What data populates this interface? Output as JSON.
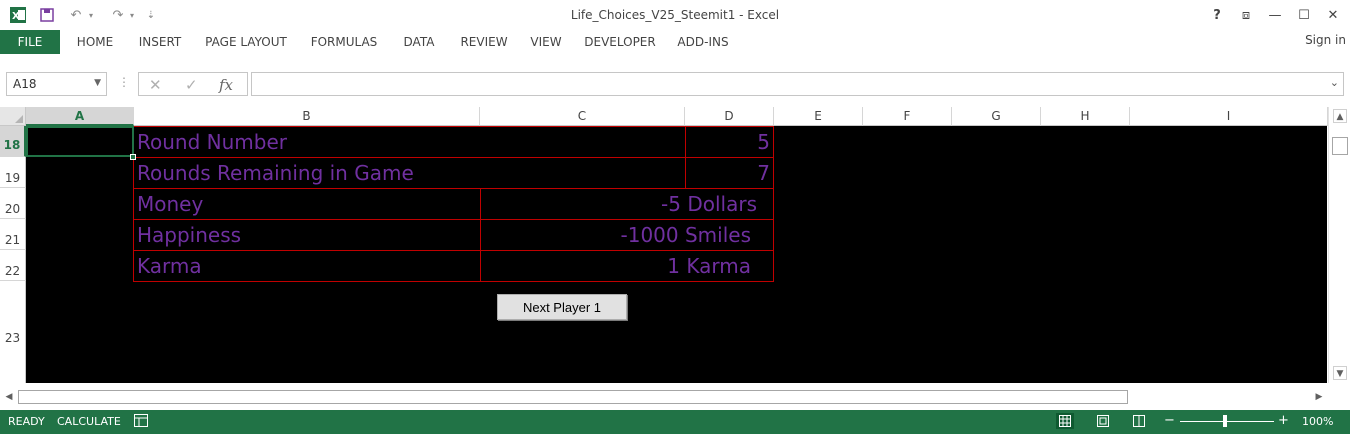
{
  "window": {
    "title": "Life_Choices_V25_Steemit1 - Excel",
    "help_icon": "?",
    "restore_ribbon_icon": "⧈",
    "minimize_icon": "—",
    "maximize_icon": "☐",
    "close_icon": "✕"
  },
  "quick_access": {
    "save_icon": "💾",
    "undo_icon": "↶",
    "redo_icon": "↷",
    "customize_icon": "⇣"
  },
  "ribbon": {
    "tabs": [
      "FILE",
      "HOME",
      "INSERT",
      "PAGE LAYOUT",
      "FORMULAS",
      "DATA",
      "REVIEW",
      "VIEW",
      "DEVELOPER",
      "ADD-INS"
    ],
    "signin": "Sign in"
  },
  "formula_bar": {
    "name_box": "A18",
    "cancel_icon": "✕",
    "enter_icon": "✓",
    "fx_label": "fx",
    "formula": ""
  },
  "columns": [
    "A",
    "B",
    "C",
    "D",
    "E",
    "F",
    "G",
    "H",
    "I"
  ],
  "rows": [
    "18",
    "19",
    "20",
    "21",
    "22",
    "23"
  ],
  "sheet": {
    "round_number_label": "Round Number",
    "round_number_value": "5",
    "rounds_remaining_label": "Rounds Remaining in Game",
    "rounds_remaining_value": "7",
    "money_label": "Money",
    "money_value": "-5 Dollars",
    "happiness_label": "Happiness",
    "happiness_value": "-1000 Smiles",
    "karma_label": "Karma",
    "karma_value": "1 Karma",
    "button_label": "Next Player 1"
  },
  "colors": {
    "excel_green": "#217346",
    "cell_text": "#7030a0",
    "cell_border": "#c00000",
    "sheet_background": "#000000"
  },
  "status_bar": {
    "ready": "READY",
    "calculate": "CALCULATE",
    "zoom": "100%",
    "zoom_out": "−",
    "zoom_in": "+"
  }
}
